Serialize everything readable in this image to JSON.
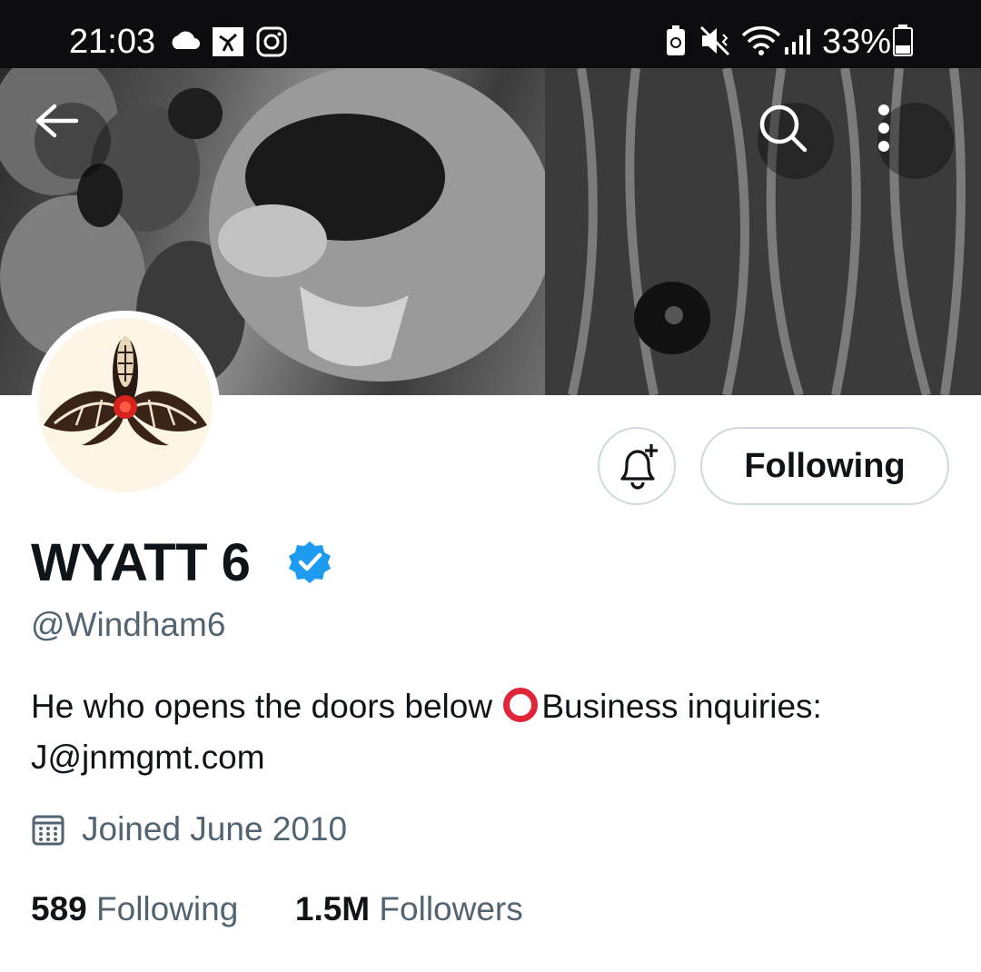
{
  "status_bar": {
    "time": "21:03",
    "battery_percent": "33%",
    "left_icons": [
      "cloud-icon",
      "app-notification-icon",
      "instagram-icon"
    ],
    "right_icons": [
      "battery-saver-icon",
      "mute-icon",
      "wifi-icon",
      "signal-icon",
      "battery-icon"
    ]
  },
  "header": {
    "back_icon": "back-arrow-icon",
    "search_icon": "search-icon",
    "more_icon": "more-vertical-icon"
  },
  "profile": {
    "display_name": "WYATT 6",
    "verified": true,
    "handle": "@Windham6",
    "bio_part1": "He who opens the doors below ",
    "bio_part2": "Business inquiries: J@jnmgmt.com",
    "joined": "Joined June 2010",
    "following_count": "589",
    "following_label": "Following",
    "followers_count": "1.5M",
    "followers_label": "Followers"
  },
  "actions": {
    "notify_icon": "bell-plus-icon",
    "follow_state_label": "Following"
  },
  "colors": {
    "verified_blue": "#1d9bf0",
    "secondary_text": "#536471",
    "bio_circle": "#e0243a"
  }
}
